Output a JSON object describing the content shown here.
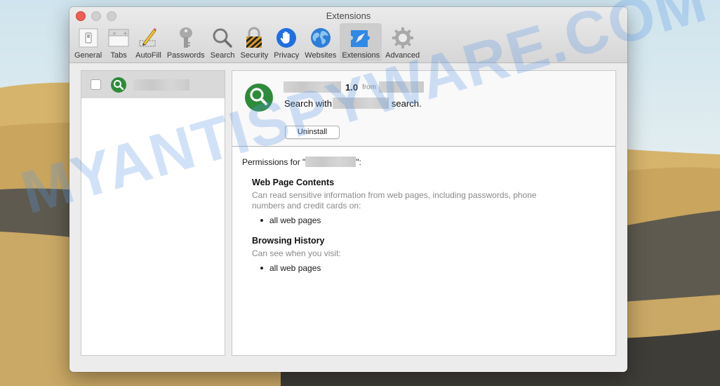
{
  "window": {
    "title": "Extensions"
  },
  "toolbar": {
    "items": [
      {
        "label": "General",
        "icon": "general-switch-icon"
      },
      {
        "label": "Tabs",
        "icon": "tabs-icon"
      },
      {
        "label": "AutoFill",
        "icon": "pencil-icon"
      },
      {
        "label": "Passwords",
        "icon": "key-icon"
      },
      {
        "label": "Search",
        "icon": "magnifier-icon"
      },
      {
        "label": "Security",
        "icon": "lock-icon"
      },
      {
        "label": "Privacy",
        "icon": "hand-icon"
      },
      {
        "label": "Websites",
        "icon": "globe-icon"
      },
      {
        "label": "Extensions",
        "icon": "puzzle-compass-icon"
      },
      {
        "label": "Advanced",
        "icon": "gear-icon"
      }
    ],
    "active": "Extensions"
  },
  "extension_list": {
    "items": [
      {
        "name_redacted": true,
        "enabled": false,
        "icon": "green-search-icon"
      }
    ]
  },
  "extension_detail": {
    "version": "1.0",
    "from_label": "from",
    "desc_prefix": "Search with",
    "desc_suffix": "search.",
    "uninstall_label": "Uninstall",
    "permissions_prefix": "Permissions for \"",
    "permissions_suffix": "\":",
    "permissions": [
      {
        "heading": "Web Page Contents",
        "description": "Can read sensitive information from web pages, including passwords, phone numbers and credit cards on:",
        "items": [
          "all web pages"
        ]
      },
      {
        "heading": "Browsing History",
        "description": "Can see when you visit:",
        "items": [
          "all web pages"
        ]
      }
    ]
  },
  "watermark": "MYANTISPYWARE.COM",
  "colors": {
    "extension_green": "#2e8b3a",
    "close_red": "#ec5f57",
    "selection_gray": "#d9d9d9",
    "watermark_blue": "#5a96e6"
  }
}
